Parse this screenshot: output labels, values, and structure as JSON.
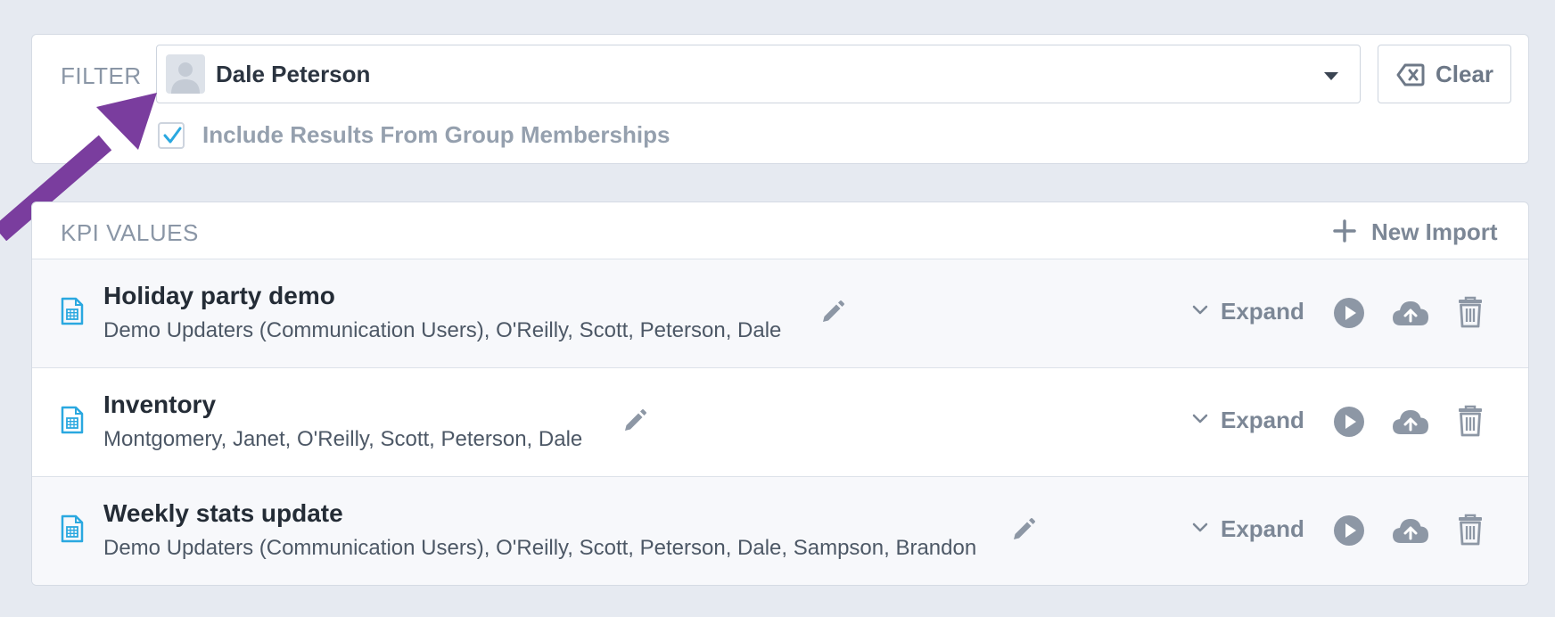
{
  "filter": {
    "label": "FILTER",
    "selected_user": "Dale Peterson",
    "clear_label": "Clear",
    "include_groups": {
      "checked": true,
      "label": "Include Results From Group Memberships"
    }
  },
  "kpi": {
    "title": "KPI VALUES",
    "new_import_label": "New Import",
    "rows": [
      {
        "title": "Holiday party demo",
        "users": "Demo Updaters (Communication Users), O'Reilly, Scott, Peterson, Dale",
        "expand_label": "Expand"
      },
      {
        "title": "Inventory",
        "users": "Montgomery, Janet, O'Reilly, Scott, Peterson, Dale",
        "expand_label": "Expand"
      },
      {
        "title": "Weekly stats update",
        "users": "Demo Updaters (Communication Users), O'Reilly, Scott, Peterson, Dale, Sampson, Brandon",
        "expand_label": "Expand"
      }
    ]
  },
  "icons": {
    "row": [
      "spreadsheet-file-icon",
      "edit-pencil-icon",
      "chevron-down-icon",
      "play-icon",
      "cloud-upload-icon",
      "trash-icon"
    ],
    "filter": [
      "avatar-placeholder-icon",
      "dropdown-caret-icon",
      "backspace-clear-icon",
      "checkmark-icon"
    ],
    "header": [
      "plus-icon"
    ]
  },
  "colors": {
    "accent": "#2aa8e0",
    "annotation_arrow": "#7a3d9e",
    "icon_gray": "#8d97a5",
    "background": "#e6eaf1"
  }
}
